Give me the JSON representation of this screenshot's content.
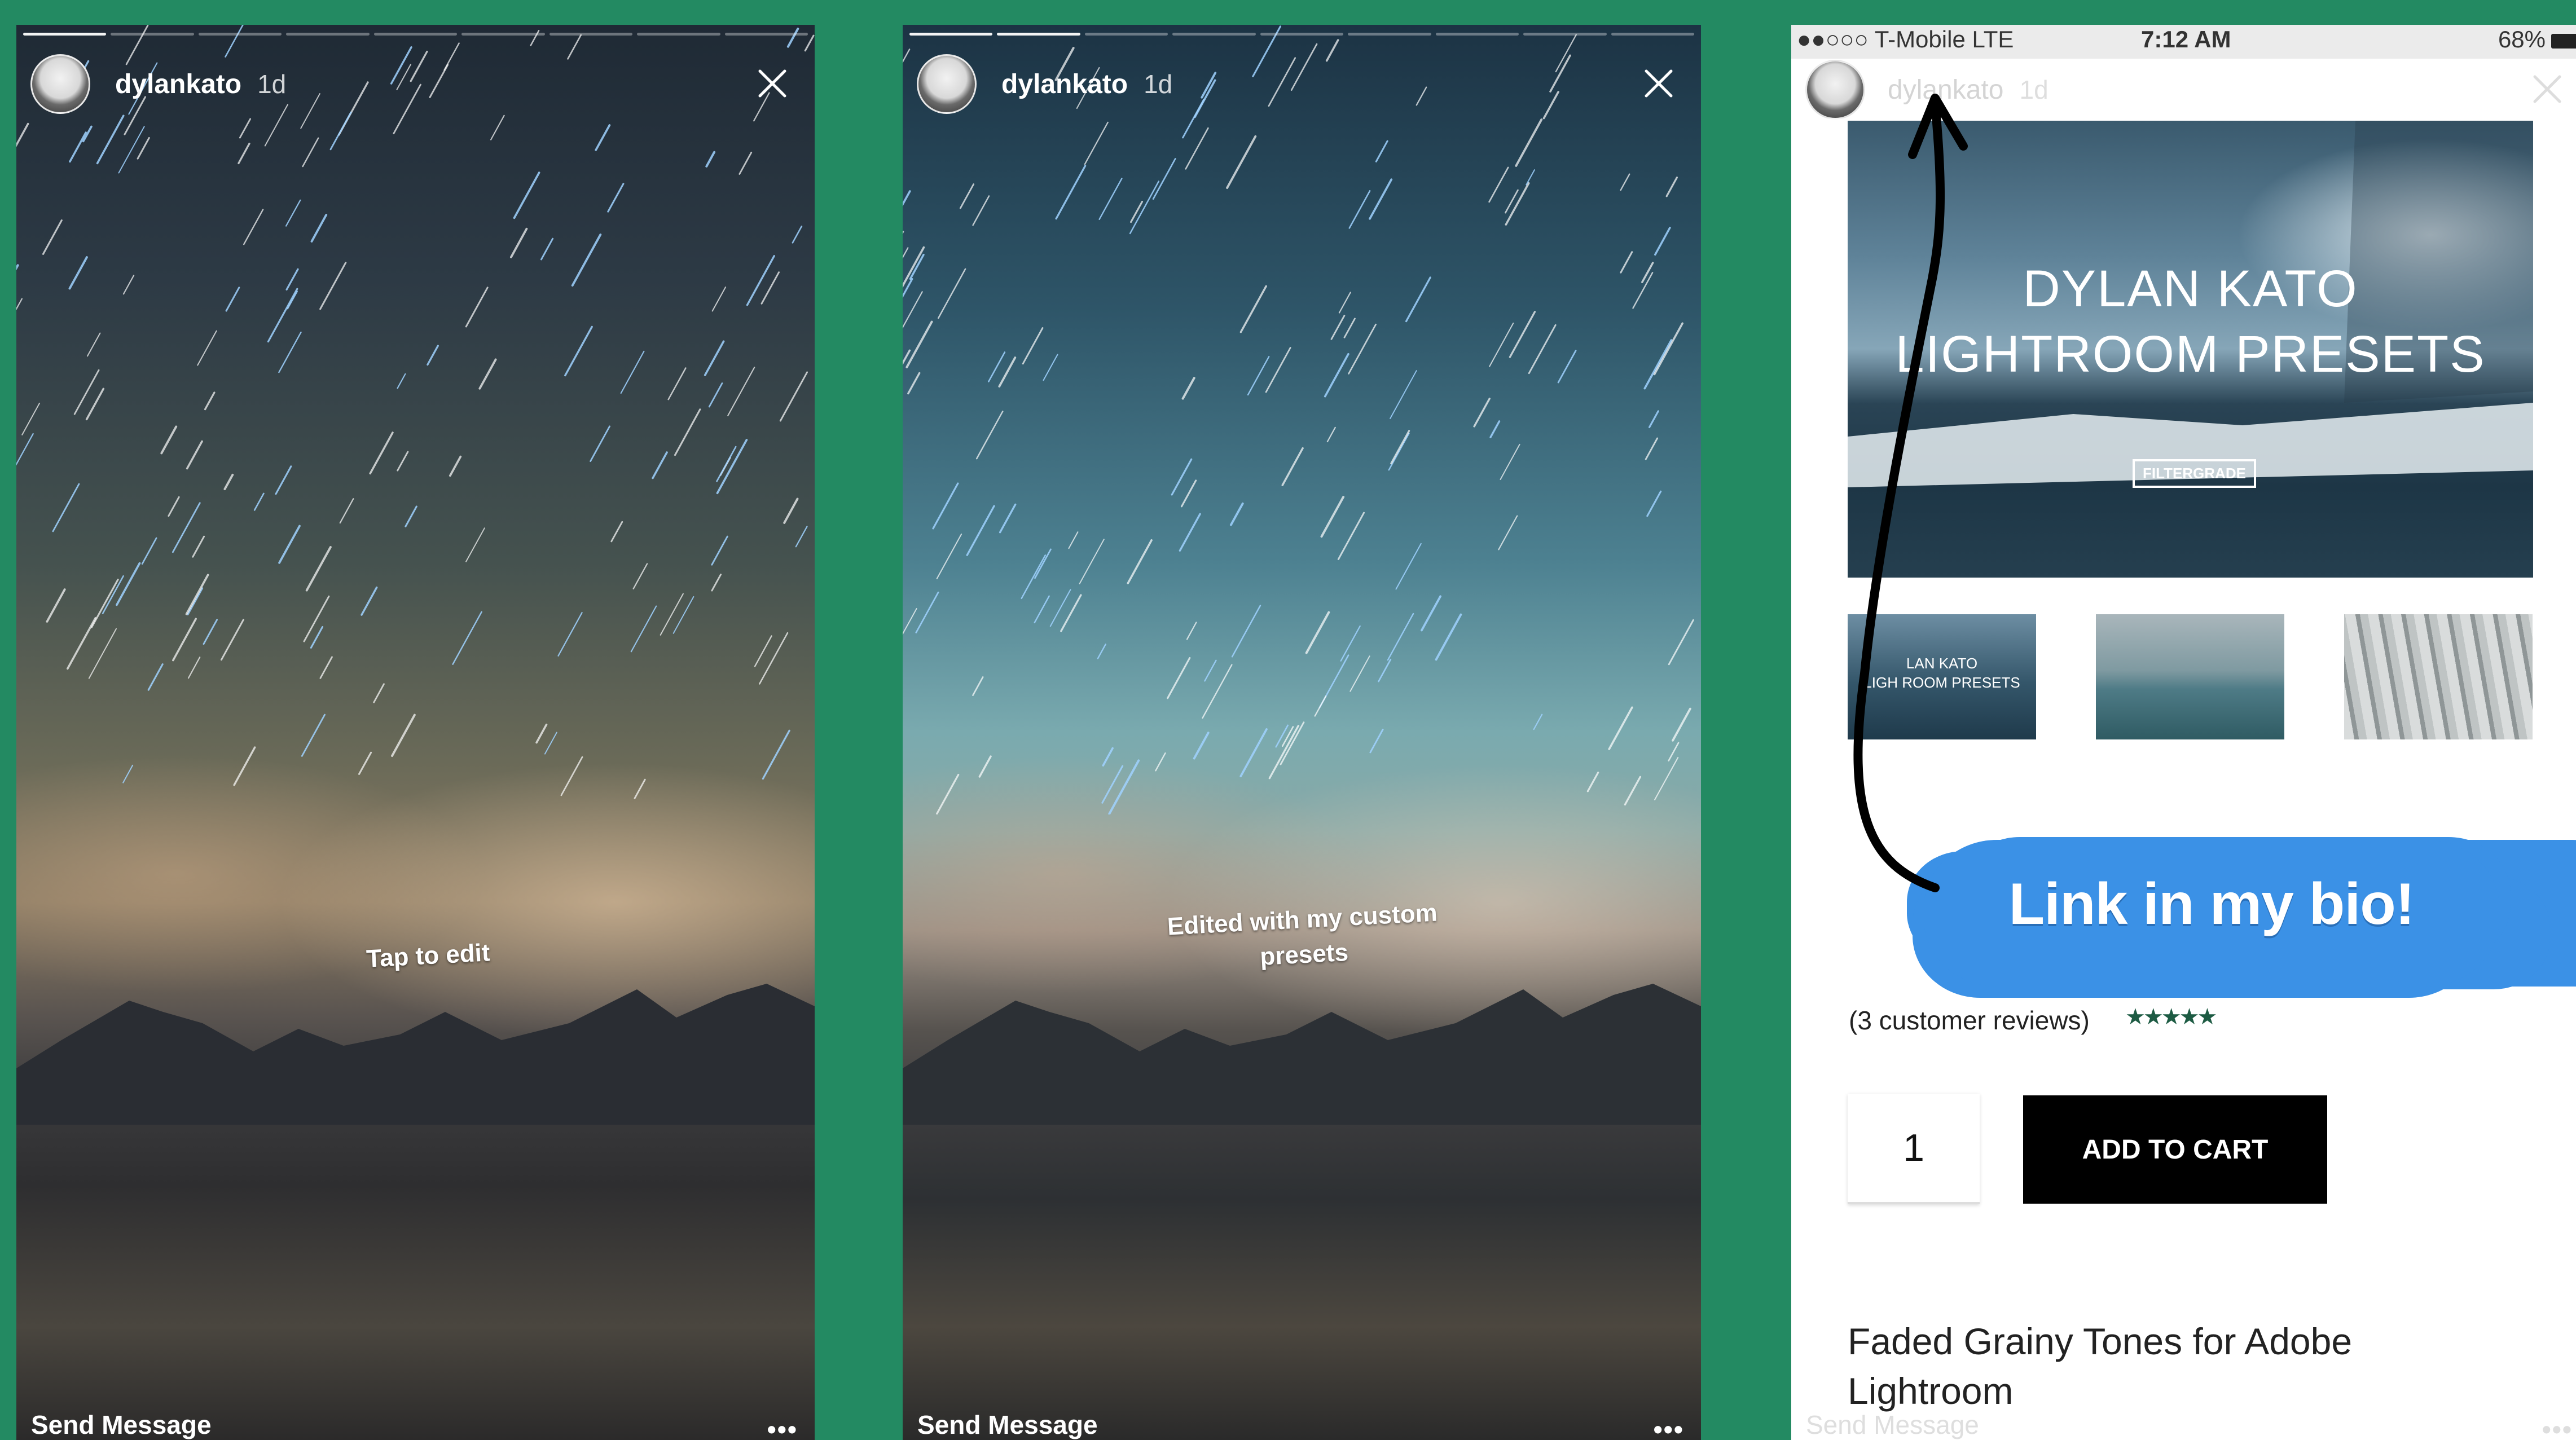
{
  "stories": [
    {
      "username": "dylankato",
      "age": "1d",
      "caption": "Tap to edit",
      "progress_active_segment": 1,
      "segments": 9,
      "footer_label": "Send Message",
      "more_label": "•••"
    },
    {
      "username": "dylankato",
      "age": "1d",
      "caption": "Edited with my custom presets",
      "progress_active_segment": 2,
      "segments": 9,
      "footer_label": "Send Message",
      "more_label": "•••"
    },
    {
      "status_bar": {
        "carrier": "●●○○○ T-Mobile  LTE",
        "time": "7:12 AM",
        "battery": "68%"
      },
      "username": "dylankato",
      "age": "1d",
      "hero_title_line1": "DYLAN KATO",
      "hero_title_line2": "LIGHTROOM PRESETS",
      "hero_badge": "FILTERGRADE",
      "thumb1_text": "LAN KATO\nLIGH ROOM PRESETS",
      "sticker_text": "Link in my bio!",
      "reviews": "(3 customer reviews)",
      "rating_stars": "★★★★★",
      "quantity": "1",
      "add_to_cart": "ADD TO CART",
      "product_title": "Faded Grainy Tones for Adobe Lightroom",
      "footer_label": "Send Message",
      "more_label": "•••"
    }
  ]
}
